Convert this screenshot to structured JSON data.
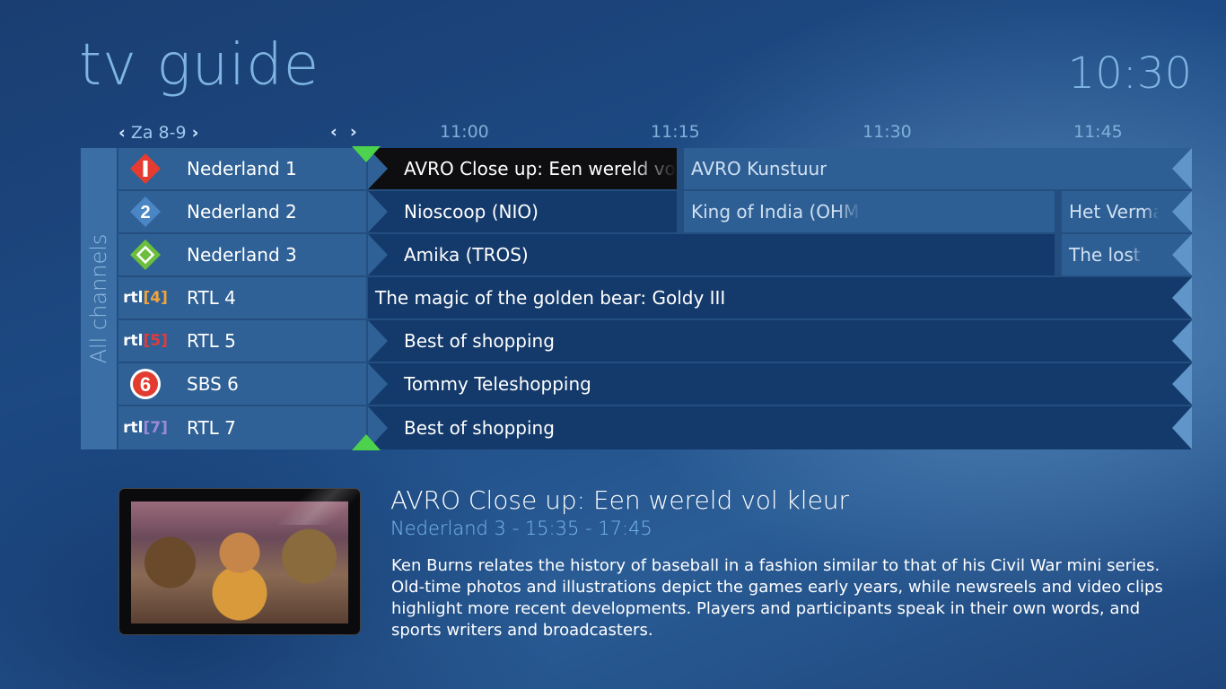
{
  "header": {
    "title": "tv guide",
    "clock": "10:30"
  },
  "date_nav": {
    "label": "Za 8-9",
    "prev_icon": "chevron-left-icon",
    "next_icon": "chevron-right-icon"
  },
  "time_nav": {
    "prev_icon": "chevron-left-icon",
    "next_icon": "chevron-right-icon"
  },
  "timeline": [
    "11:00",
    "11:15",
    "11:30",
    "11:45"
  ],
  "sidebar": {
    "label": "All channels"
  },
  "channels": [
    {
      "name": "Nederland 1",
      "logo": "npo1-logo",
      "programs": [
        "AVRO Close up: Een wereld vol kleur",
        "AVRO Kunstuur"
      ]
    },
    {
      "name": "Nederland 2",
      "logo": "npo2-logo",
      "programs": [
        "Nioscoop (NIO)",
        "King of India (OHM)",
        "Het Vermaak"
      ]
    },
    {
      "name": "Nederland 3",
      "logo": "npo3-logo",
      "programs": [
        "Amika (TROS)",
        "The lost tapes"
      ]
    },
    {
      "name": "RTL 4",
      "logo": "rtl4-logo",
      "logo_text": "rtl",
      "logo_num": "4",
      "programs": [
        "The magic of the golden bear: Goldy III"
      ]
    },
    {
      "name": "RTL 5",
      "logo": "rtl5-logo",
      "logo_text": "rtl",
      "logo_num": "5",
      "programs": [
        "Best of shopping"
      ]
    },
    {
      "name": "SBS 6",
      "logo": "sbs6-logo",
      "programs": [
        "Tommy Teleshopping"
      ]
    },
    {
      "name": "RTL 7",
      "logo": "rtl7-logo",
      "logo_text": "rtl",
      "logo_num": "7",
      "programs": [
        "Best of shopping"
      ]
    }
  ],
  "details": {
    "title": "AVRO Close up: Een wereld vol kleur",
    "meta": "Nederland 3 - 15:35 - 17:45",
    "description": "Ken Burns relates the history of baseball in a fashion similar to that of his Civil War mini series. Old-time photos and illustrations depict the games early years, while newsreels and video clips highlight more recent developments. Players and participants speak in their own words, and sports writers and broadcasters."
  },
  "colors": {
    "accent": "#7fb5e3",
    "now_marker": "#4dd24d",
    "selected_program": "#0e0e10",
    "rtl4": "#f2a33a",
    "rtl5": "#e23b3b",
    "rtl7": "#9b8ad8",
    "npo1": "#e53b30",
    "npo2": "#4b86c4",
    "npo3": "#6cbf3c"
  }
}
